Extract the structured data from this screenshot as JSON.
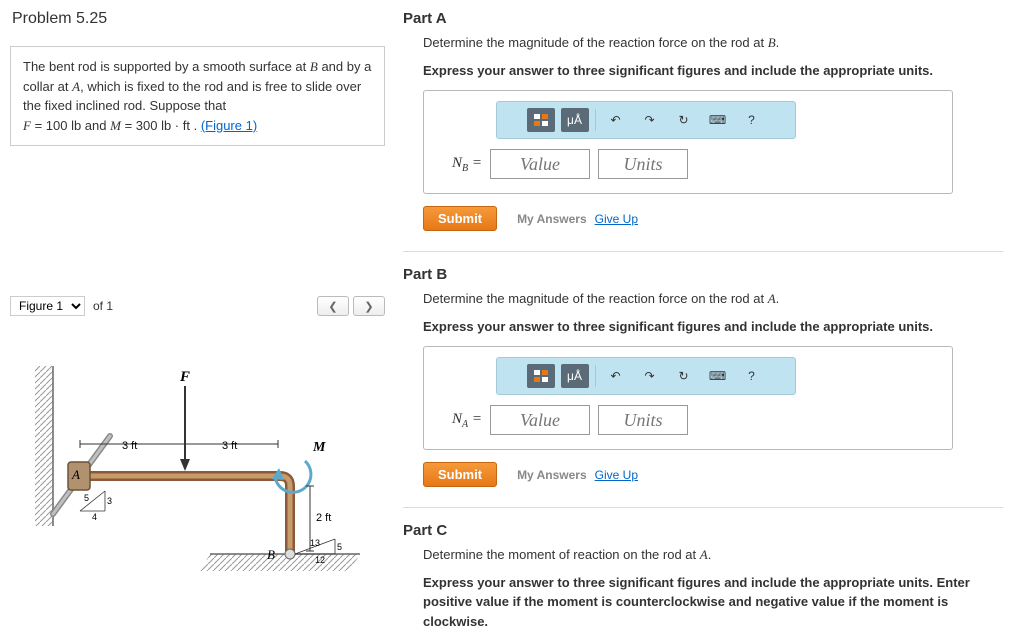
{
  "problem_title": "Problem 5.25",
  "description": {
    "line1": "The bent rod is supported by a smooth surface at ",
    "B": "B",
    "line2": " and by a collar at ",
    "A": "A",
    "line3": ", which is fixed to the rod and is free to slide over the fixed inclined rod. Suppose that",
    "eqF": "F",
    "eq1": " = 100  lb and ",
    "eqM": "M",
    "eq2": " = 300  lb · ft . ",
    "fig_link": "(Figure 1)"
  },
  "figure": {
    "select": "Figure 1",
    "of": "of 1",
    "prev": "❮",
    "next": "❯",
    "labels": {
      "F": "F",
      "M": "M",
      "A": "A",
      "B": "B",
      "d1": "3 ft",
      "d2": "3 ft",
      "d3": "2 ft",
      "r1": "3",
      "r2": "4",
      "r3": "5",
      "r4": "13",
      "r5": "12",
      "r6": "5"
    }
  },
  "partA": {
    "title": "Part A",
    "desc": "Determine the magnitude of the reaction force on the rod at ",
    "desc_end": ".",
    "var": "B",
    "bold": "Express your answer to three significant figures and include the appropriate units.",
    "label_pre": "N",
    "label_sub": "B",
    "label_eq": " =",
    "value_ph": "Value",
    "units_ph": "Units"
  },
  "partB": {
    "title": "Part B",
    "desc": "Determine the magnitude of the reaction force on the rod at ",
    "desc_end": ".",
    "var": "A",
    "bold": "Express your answer to three significant figures and include the appropriate units.",
    "label_pre": "N",
    "label_sub": "A",
    "label_eq": " =",
    "value_ph": "Value",
    "units_ph": "Units"
  },
  "partC": {
    "title": "Part C",
    "desc": "Determine the moment of reaction on the rod at ",
    "desc_end": ".",
    "var": "A",
    "bold": "Express your answer to three significant figures and include the appropriate units. Enter positive value if the moment is counterclockwise and negative value if the moment is clockwise."
  },
  "buttons": {
    "submit": "Submit",
    "my_answers": "My Answers",
    "give_up": "Give Up"
  },
  "toolbar": {
    "t1": "μÅ",
    "undo": "↶",
    "redo": "↷",
    "reset": "↻",
    "kb": "⌨",
    "help": "?"
  }
}
